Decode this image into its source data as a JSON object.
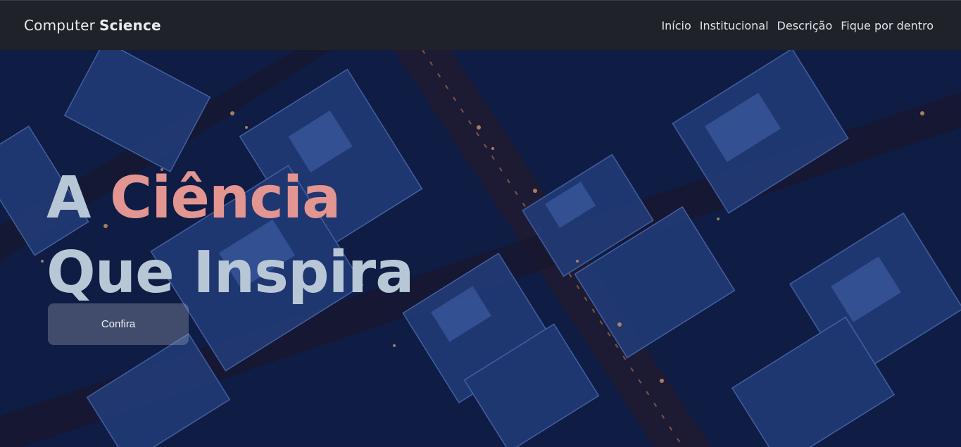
{
  "navbar": {
    "brand_regular": "Computer",
    "brand_bold": "Science",
    "links": [
      {
        "label": "Início"
      },
      {
        "label": "Institucional"
      },
      {
        "label": "Descrição"
      },
      {
        "label": "Fique por dentro"
      }
    ]
  },
  "hero": {
    "title_word1": "A",
    "title_accent": "Ciência",
    "title_line2": "Que Inspira",
    "cta_label": "Confira"
  },
  "colors": {
    "navbar_bg": "#1f2329",
    "title": "#b7c7d6",
    "accent": "#e39591",
    "hero_bg": "#0e1a3d"
  }
}
